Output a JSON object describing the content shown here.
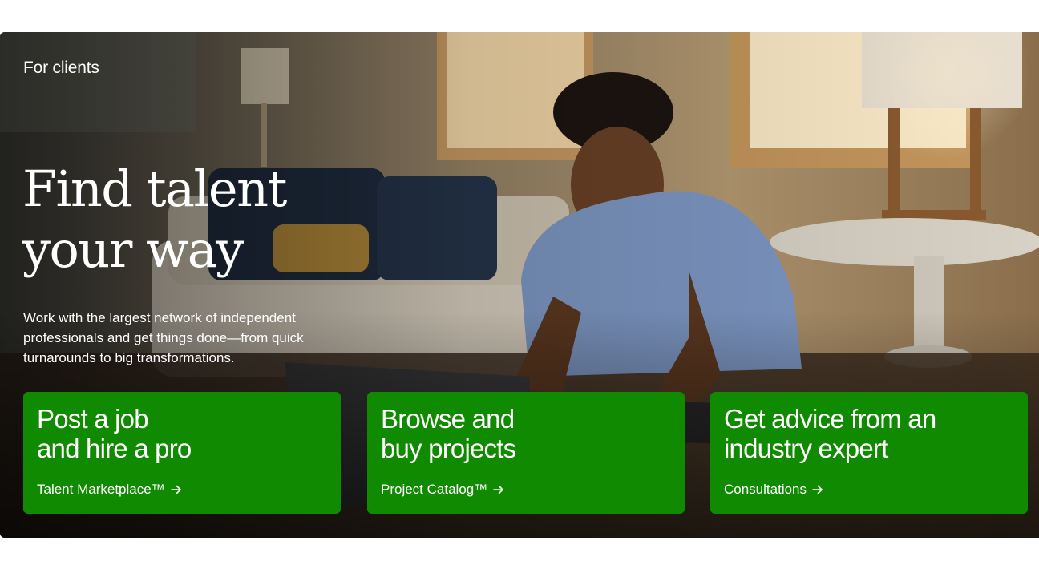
{
  "hero": {
    "eyebrow": "For clients",
    "headline_line1": "Find talent",
    "headline_line2": "your way",
    "subtext": "Work with the largest network of independent professionals and get things done—from quick turnarounds to big transformations."
  },
  "cards": [
    {
      "title_line1": "Post a job",
      "title_line2": "and hire a pro",
      "link": "Talent Marketplace™",
      "icon": "arrow-right-icon"
    },
    {
      "title_line1": "Browse and",
      "title_line2": "buy projects",
      "link": "Project Catalog™",
      "icon": "arrow-right-icon"
    },
    {
      "title_line1": "Get advice from an",
      "title_line2": "industry expert",
      "link": "Consultations",
      "icon": "arrow-right-icon"
    }
  ],
  "colors": {
    "card_green": "#108a00",
    "text": "#ffffff"
  }
}
